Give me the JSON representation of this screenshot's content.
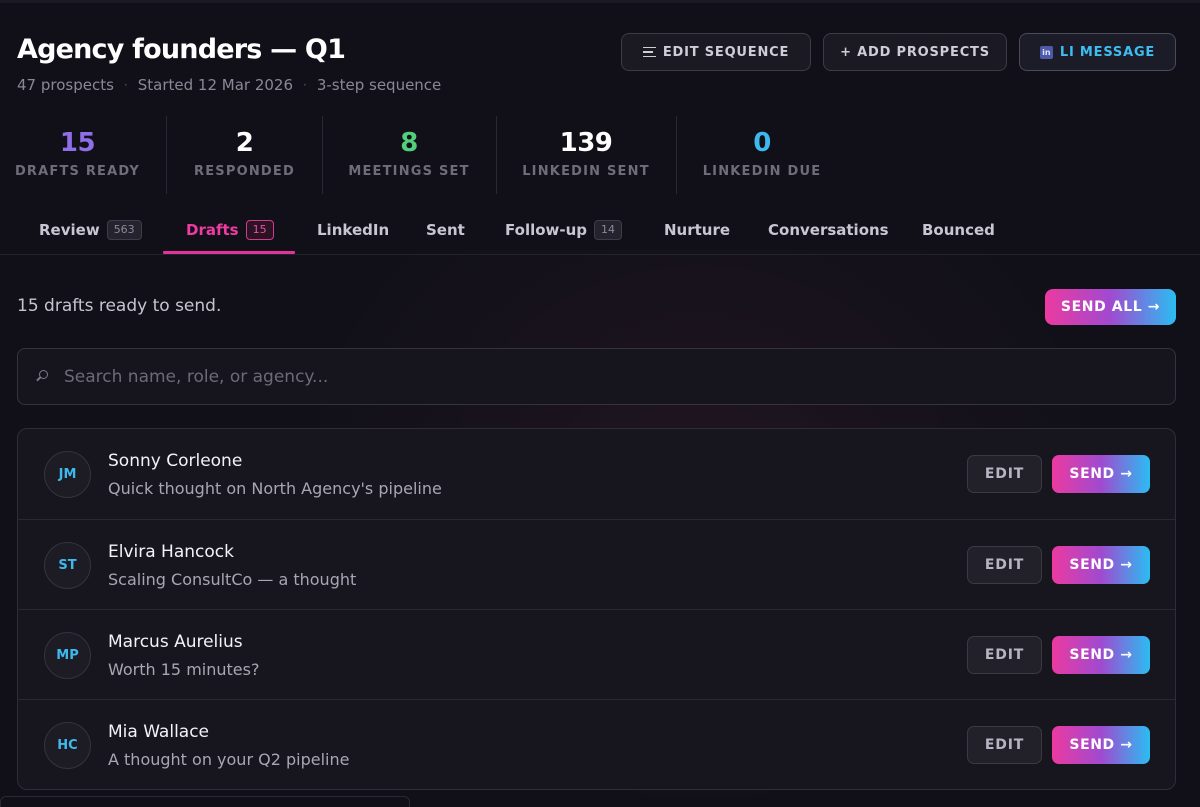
{
  "header": {
    "title": "Agency founders — Q1",
    "meta": [
      "47 prospects",
      "Started 12 Mar 2026",
      "3-step sequence"
    ],
    "buttons": {
      "edit_sequence": "EDIT SEQUENCE",
      "add_prospects": "+ ADD PROSPECTS",
      "li_message": "LI MESSAGE",
      "li_badge": "in"
    }
  },
  "stats": [
    {
      "value": "15",
      "label": "DRAFTS READY",
      "color": "#8f6fe8"
    },
    {
      "value": "2",
      "label": "RESPONDED",
      "color": "#ffffff"
    },
    {
      "value": "8",
      "label": "MEETINGS SET",
      "color": "#52cf7a"
    },
    {
      "value": "139",
      "label": "LINKEDIN SENT",
      "color": "#ffffff"
    },
    {
      "value": "0",
      "label": "LINKEDIN DUE",
      "color": "#3eb9ee"
    }
  ],
  "tabs": [
    {
      "label": "Review",
      "count": "563"
    },
    {
      "label": "Drafts",
      "count": "15",
      "active": true
    },
    {
      "label": "LinkedIn"
    },
    {
      "label": "Sent"
    },
    {
      "label": "Follow-up",
      "count": "14"
    },
    {
      "label": "Nurture"
    },
    {
      "label": "Conversations"
    },
    {
      "label": "Bounced"
    }
  ],
  "drafts": {
    "summary": "15 drafts ready to send.",
    "send_all": "SEND ALL →",
    "search_placeholder": "Search name, role, or agency...",
    "rows": [
      {
        "initials": "JM",
        "name": "Sonny Corleone",
        "subject": "Quick thought on North Agency's pipeline",
        "edit": "EDIT",
        "send": "SEND →"
      },
      {
        "initials": "ST",
        "name": "Elvira Hancock",
        "subject": "Scaling ConsultCo — a thought",
        "edit": "EDIT",
        "send": "SEND →"
      },
      {
        "initials": "MP",
        "name": "Marcus Aurelius",
        "subject": "Worth 15 minutes?",
        "edit": "EDIT",
        "send": "SEND →"
      },
      {
        "initials": "HC",
        "name": "Mia Wallace",
        "subject": "A thought on your Q2 pipeline",
        "edit": "EDIT",
        "send": "SEND →"
      }
    ]
  },
  "colors": {
    "accent_pink": "#e2339a",
    "accent_blue": "#2bbdf2",
    "background": "#111018"
  }
}
